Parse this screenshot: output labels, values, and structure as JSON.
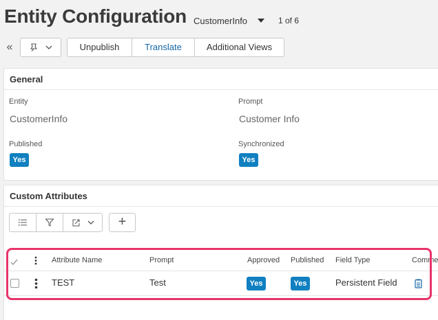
{
  "header": {
    "title": "Entity Configuration",
    "record_selector": "CustomerInfo",
    "record_count": "1 of 6"
  },
  "toolbar": {
    "collapse_glyph": "«",
    "unpublish_label": "Unpublish",
    "translate_label": "Translate",
    "additional_views_label": "Additional Views"
  },
  "general": {
    "title": "General",
    "entity_label": "Entity",
    "entity_value": "CustomerInfo",
    "prompt_label": "Prompt",
    "prompt_value": "Customer Info",
    "published_label": "Published",
    "published_value": "Yes",
    "synchronized_label": "Synchronized",
    "synchronized_value": "Yes"
  },
  "custom_attributes": {
    "title": "Custom Attributes",
    "add_glyph": "+",
    "columns": {
      "attribute_name": "Attribute Name",
      "prompt": "Prompt",
      "approved": "Approved",
      "published": "Published",
      "field_type": "Field Type",
      "comments": "Comme"
    },
    "rows": [
      {
        "attribute_name": "TEST",
        "prompt": "Test",
        "approved": "Yes",
        "published": "Yes",
        "field_type": "Persistent Field"
      }
    ]
  },
  "colors": {
    "accent": "#1080c0",
    "link_blue": "#1466a8",
    "highlight": "#e8336a"
  },
  "icons": [
    "pin-icon",
    "chevron-down-icon",
    "list-icon",
    "filter-icon",
    "export-icon",
    "plus-icon",
    "kebab-icon",
    "checkmark-icon",
    "comment-icon"
  ]
}
